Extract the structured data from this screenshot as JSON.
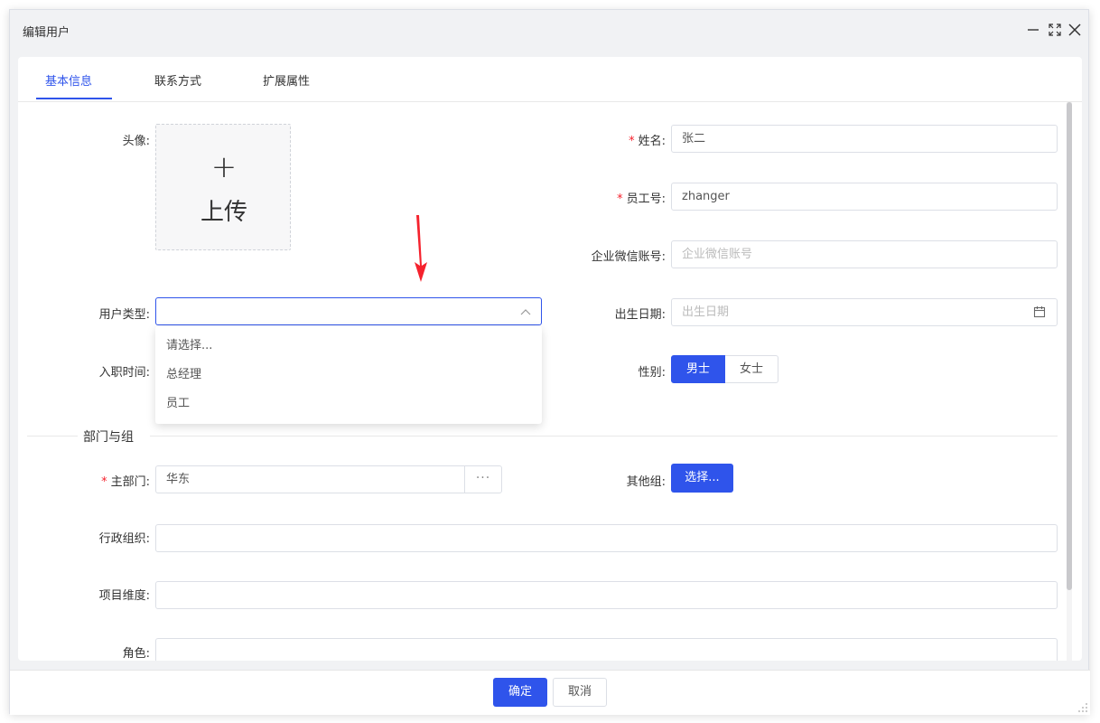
{
  "dialog": {
    "title": "编辑用户",
    "controls": {
      "minimize": "—",
      "maximize": "⛶",
      "close": "✕"
    }
  },
  "tabs": [
    {
      "label": "基本信息",
      "active": true
    },
    {
      "label": "联系方式",
      "active": false
    },
    {
      "label": "扩展属性",
      "active": false
    }
  ],
  "form": {
    "avatar": {
      "label": "头像:",
      "upload_plus": "+",
      "upload_text": "上传"
    },
    "name": {
      "label": "姓名:",
      "required": "*",
      "value": "张二"
    },
    "employee_no": {
      "label": "员工号:",
      "required": "*",
      "value": "zhanger"
    },
    "wechat": {
      "label": "企业微信账号:",
      "placeholder": "企业微信账号"
    },
    "user_type": {
      "label": "用户类型:",
      "value": "",
      "options": [
        "请选择...",
        "总经理",
        "员工"
      ]
    },
    "birthday": {
      "label": "出生日期:",
      "placeholder": "出生日期"
    },
    "hire_date": {
      "label": "入职时间:"
    },
    "gender": {
      "label": "性别:",
      "options": [
        "男士",
        "女士"
      ],
      "selected": "男士"
    },
    "section_title": "部门与组",
    "main_dept": {
      "label": "主部门:",
      "required": "*",
      "value": "华东",
      "picker": "···"
    },
    "other_group": {
      "label": "其他组:",
      "button": "选择..."
    },
    "admin_org": {
      "label": "行政组织:"
    },
    "project_dim": {
      "label": "项目维度:"
    },
    "role": {
      "label": "角色:"
    }
  },
  "footer": {
    "confirm": "确定",
    "cancel": "取消"
  },
  "colors": {
    "accent": "#2f54eb",
    "required": "#f5222d",
    "annotation_arrow": "#f5222d"
  }
}
